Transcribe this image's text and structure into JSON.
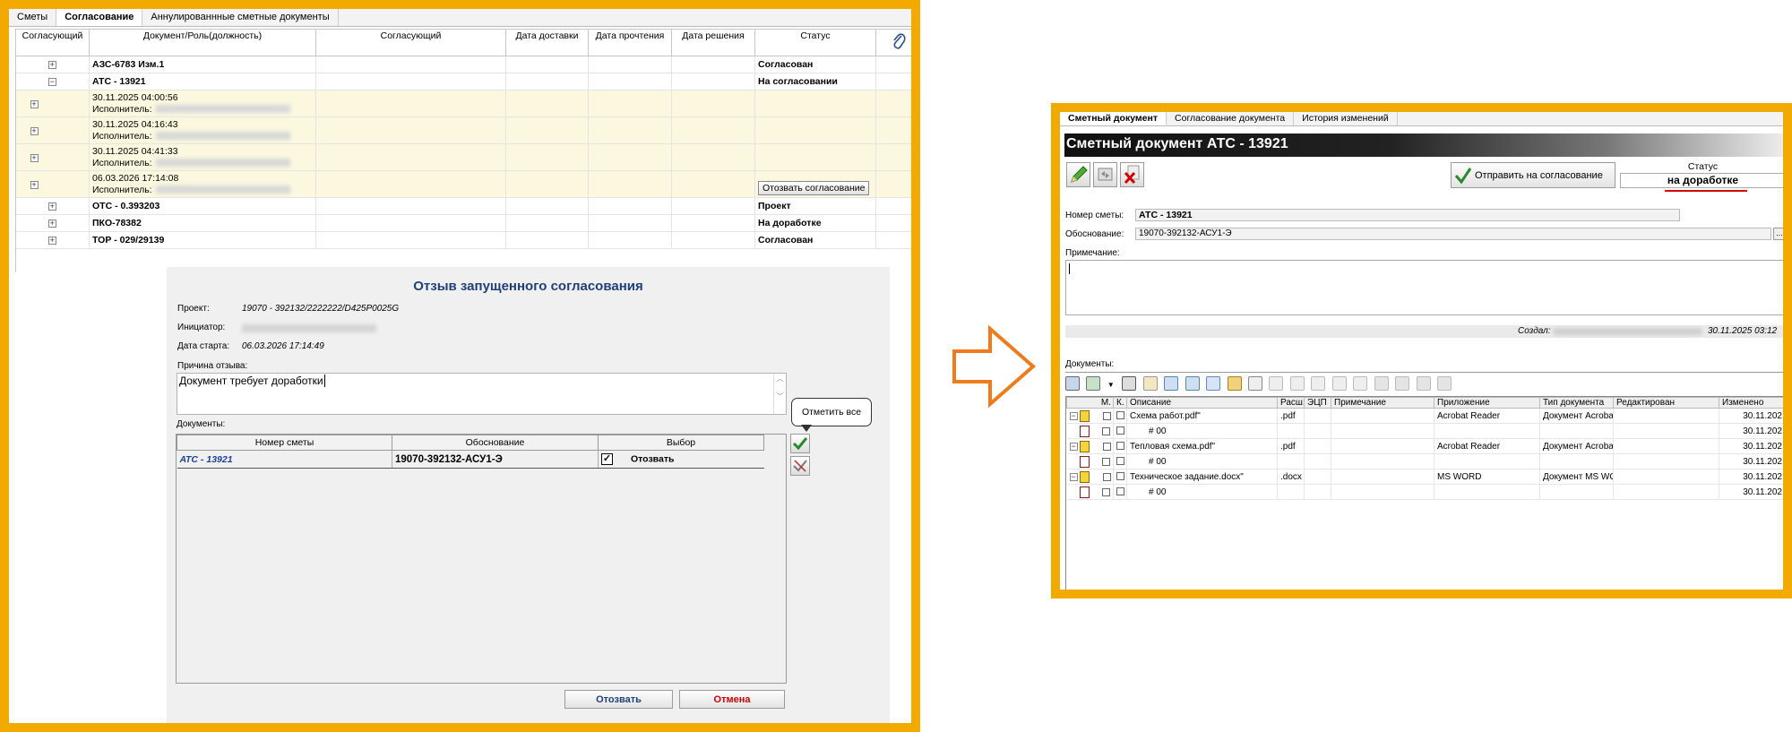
{
  "left": {
    "tabs": [
      "Сметы",
      "Согласование",
      "Аннулированнные сметные документы"
    ],
    "active_tab": 1,
    "grid_headers": [
      "Согласующий",
      "Документ/Роль(должность)",
      "Согласующий",
      "Дата доставки",
      "Дата прочтения",
      "Дата решения",
      "Статус"
    ],
    "grid_rows": [
      {
        "kind": "top",
        "expander": "+",
        "doc": "АЗС-6783 Изм.1",
        "status": "Согласован"
      },
      {
        "kind": "top",
        "expander": "−",
        "doc": "АТС - 13921",
        "status": "На согласовании"
      },
      {
        "kind": "sub",
        "expander": "+",
        "date": "30.11.2025 04:00:56",
        "role": "Исполнитель:"
      },
      {
        "kind": "sub",
        "expander": "+",
        "date": "30.11.2025 04:16:43",
        "role": "Исполнитель:"
      },
      {
        "kind": "sub",
        "expander": "+",
        "date": "30.11.2025 04:41:33",
        "role": "Исполнитель:"
      },
      {
        "kind": "sub",
        "expander": "+",
        "date": "06.03.2026 17:14:08",
        "role": "Исполнитель:",
        "action": "Отозвать согласование"
      },
      {
        "kind": "top",
        "expander": "+",
        "doc": "ОТС - 0.393203",
        "status": "Проект"
      },
      {
        "kind": "top",
        "expander": "+",
        "doc": "ПКО-78382",
        "status": "На доработке"
      },
      {
        "kind": "top",
        "expander": "+",
        "doc": "ТОР - 029/29139",
        "status": "Согласован"
      }
    ],
    "dialog": {
      "title": "Отзыв запущенного согласования",
      "project_label": "Проект:",
      "project_value": "19070 - 392132/2222222/D425P0025G",
      "initiator_label": "Инициатор:",
      "start_label": "Дата старта:",
      "start_value": "06.03.2026 17:14:49",
      "reason_label": "Причина отзыва:",
      "reason_value": "Документ требует доработки",
      "docs_label": "Документы:",
      "doc_headers": [
        "Номер сметы",
        "Обоснование",
        "Выбор"
      ],
      "doc_rows": [
        {
          "number": "АТС - 13921",
          "basis": "19070-392132-АСУ1-Э",
          "checked": true,
          "choice": "Отозвать"
        }
      ],
      "tooltip": "Отметить все",
      "btn_revoke": "Отозвать",
      "btn_cancel": "Отмена"
    }
  },
  "right": {
    "tabs": [
      "Сметный документ",
      "Согласование документа",
      "История изменений"
    ],
    "active_tab": 0,
    "header_title": "Сметный документ АТС - 13921",
    "send_button": "Отправить на согласование",
    "status_label": "Статус",
    "status_value": "на доработке",
    "number_label": "Номер сметы:",
    "number_value": "АТС - 13921",
    "basis_label": "Обоснование:",
    "basis_value": "19070-392132-АСУ1-Э",
    "basis_more": "...",
    "note_label": "Примечание:",
    "created_label": "Создал:",
    "created_date": "30.11.2025 03:12",
    "docs_label": "Документы:",
    "file_headers": [
      "М.",
      "К.",
      "Описание",
      "Расш.",
      "ЭЦП",
      "Примечание",
      "Приложение",
      "Тип документа",
      "Редактирован",
      "Изменено"
    ],
    "files": [
      {
        "name": "Схема работ.pdf\"",
        "ext": ".pdf",
        "app": "Acrobat Reader",
        "type": "Документ Acroba",
        "modified": "30.11.202",
        "version": "# 00"
      },
      {
        "name": "Тепловая схема.pdf\"",
        "ext": ".pdf",
        "app": "Acrobat Reader",
        "type": "Документ Acroba",
        "modified": "30.11.202",
        "version": "# 00"
      },
      {
        "name": "Техническое задание.docx\"",
        "ext": ".docx",
        "app": "MS WORD",
        "type": "Документ MS WO",
        "modified": "30.11.202",
        "version": "# 00"
      }
    ]
  },
  "colors": {
    "frame": "#f2a900",
    "arrow": "#f07b1a",
    "dialog_title": "#1f3f7a",
    "cancel": "#d40000",
    "sub_row": "#fbf8df"
  }
}
